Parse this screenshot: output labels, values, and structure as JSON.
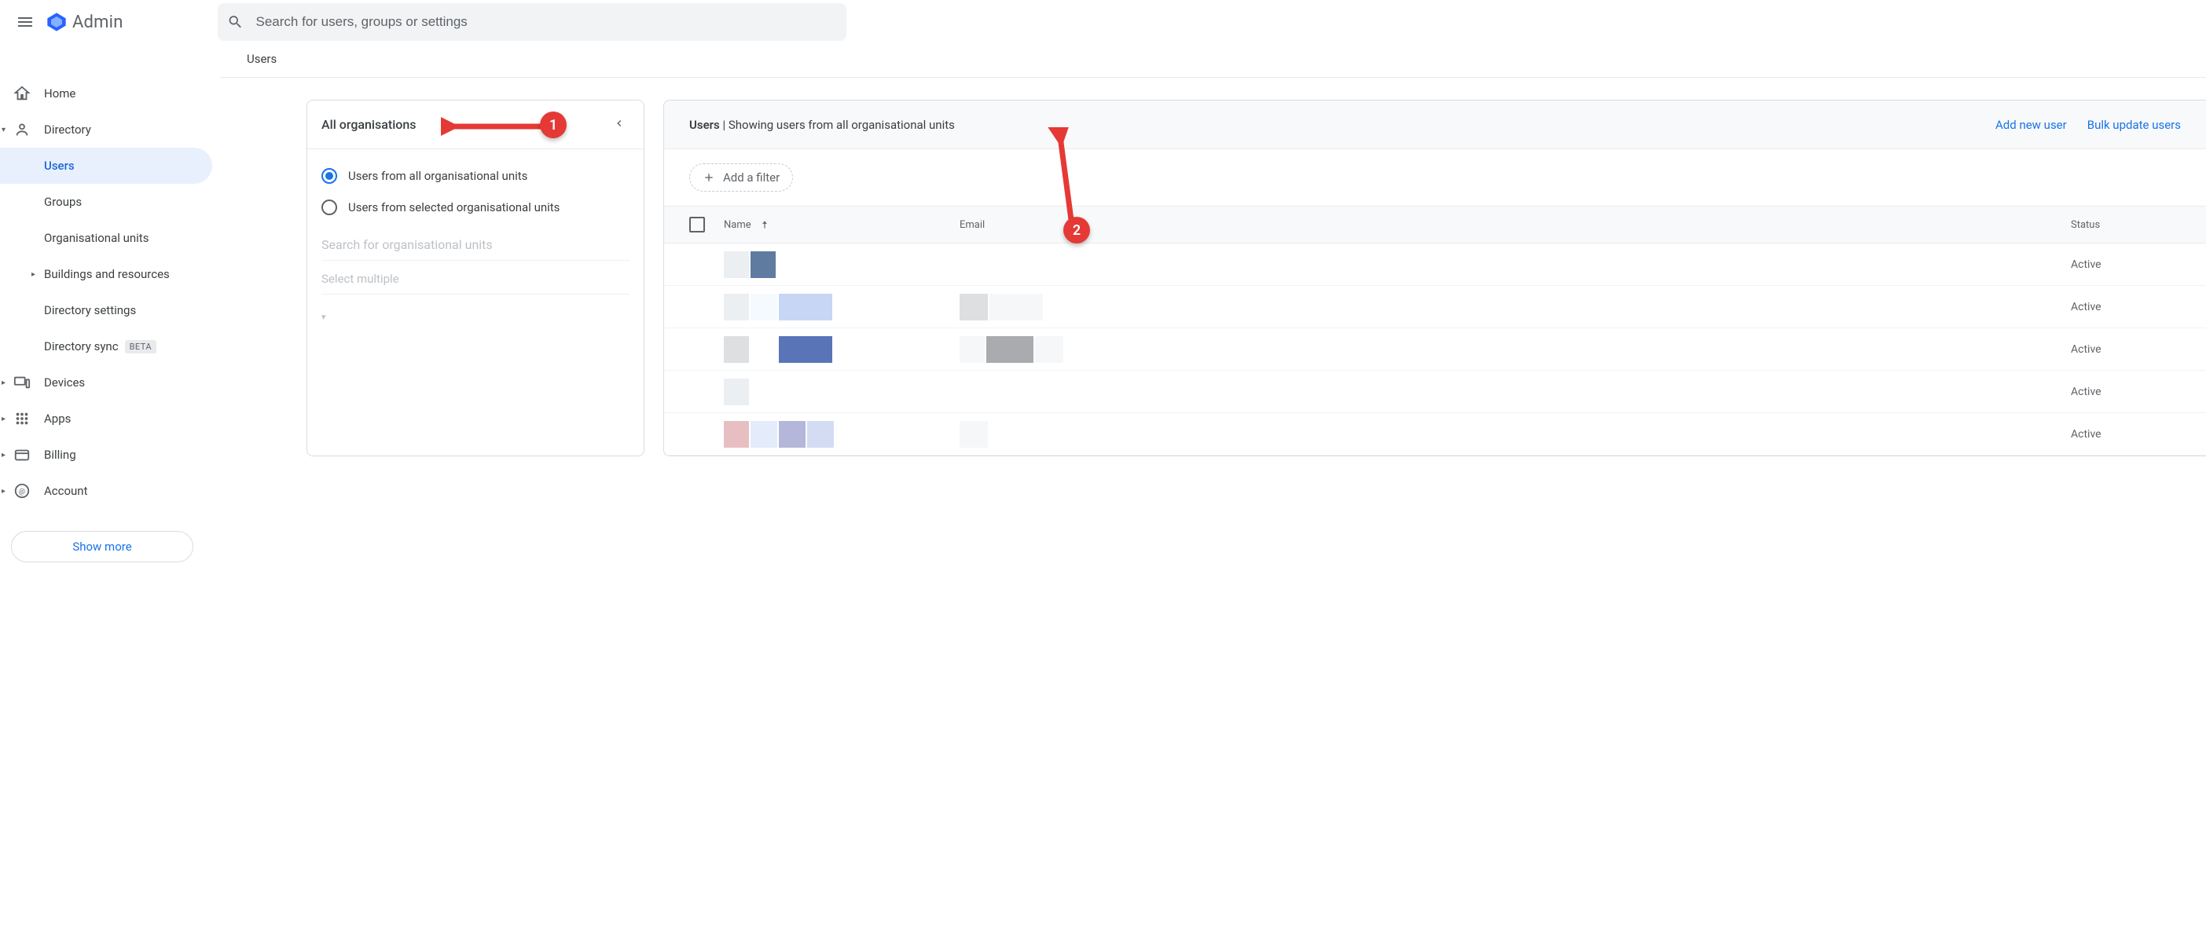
{
  "brand": {
    "name": "Admin"
  },
  "search": {
    "placeholder": "Search for users, groups or settings"
  },
  "sidebar": {
    "home": "Home",
    "directory": "Directory",
    "users": "Users",
    "groups": "Groups",
    "org_units": "Organisational units",
    "buildings": "Buildings and resources",
    "dir_settings": "Directory settings",
    "dir_sync": "Directory sync",
    "dir_sync_badge": "BETA",
    "devices": "Devices",
    "apps": "Apps",
    "billing": "Billing",
    "account": "Account",
    "show_more": "Show more"
  },
  "page_tab": "Users",
  "ou_panel": {
    "title": "All organisations",
    "option_all": "Users from all organisational units",
    "option_selected": "Users from selected organisational units",
    "search_placeholder": "Search for organisational units",
    "select_multiple": "Select multiple"
  },
  "users_panel": {
    "title_bold": "Users",
    "title_rest": " | Showing users from all organisational units",
    "add_new": "Add new user",
    "bulk_update": "Bulk update users",
    "filter_chip": "Add a filter",
    "columns": {
      "name": "Name",
      "email": "Email",
      "status": "Status"
    },
    "rows": [
      {
        "status": "Active",
        "name_blocks": [
          {
            "w": 32,
            "c": "#eceff1"
          },
          {
            "w": 32,
            "c": "#5f7ba0"
          }
        ],
        "email_blocks": []
      },
      {
        "status": "Active",
        "name_blocks": [
          {
            "w": 32,
            "c": "#eceff1"
          },
          {
            "w": 34,
            "c": "#f5faff"
          },
          {
            "w": 68,
            "c": "#c7d6f5"
          }
        ],
        "email_blocks": [
          {
            "w": 36,
            "c": "#dedfe1"
          },
          {
            "w": 68,
            "c": "#f6f7f8"
          }
        ]
      },
      {
        "status": "Active",
        "name_blocks": [
          {
            "w": 32,
            "c": "#dedfe1"
          },
          {
            "w": 34,
            "c": "#ffffff"
          },
          {
            "w": 68,
            "c": "#5a74b8"
          }
        ],
        "email_blocks": [
          {
            "w": 32,
            "c": "#f6f7f8"
          },
          {
            "w": 60,
            "c": "#a9abae"
          },
          {
            "w": 36,
            "c": "#f6f7f8"
          }
        ]
      },
      {
        "status": "Active",
        "name_blocks": [
          {
            "w": 32,
            "c": "#eceff1"
          }
        ],
        "email_blocks": []
      },
      {
        "status": "Active",
        "name_blocks": [
          {
            "w": 32,
            "c": "#e7bfc2"
          },
          {
            "w": 34,
            "c": "#e4ecfb"
          },
          {
            "w": 34,
            "c": "#b4b7d9"
          },
          {
            "w": 34,
            "c": "#d4dcf4"
          }
        ],
        "email_blocks": [
          {
            "w": 36,
            "c": "#f6f7f8"
          }
        ]
      }
    ]
  },
  "annotations": {
    "badge1": "1",
    "badge2": "2"
  }
}
